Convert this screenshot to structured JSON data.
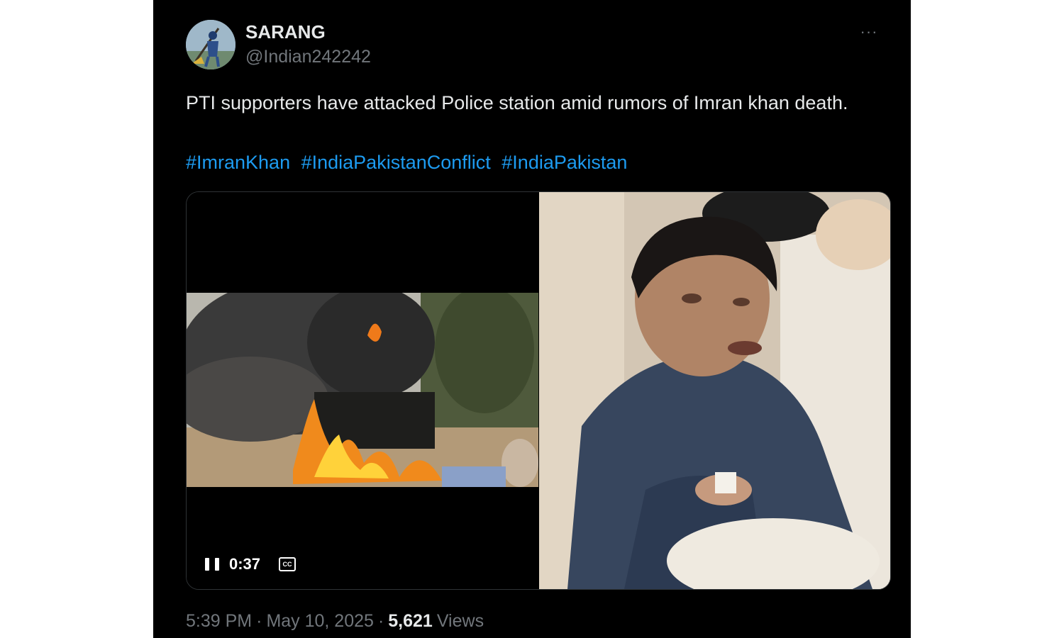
{
  "user": {
    "display_name": "SARANG",
    "handle": "@Indian242242"
  },
  "more_label": "···",
  "tweet": {
    "text": "PTI supporters have attacked Police station amid rumors of Imran khan death.",
    "hashtags": [
      "#ImranKhan",
      "#IndiaPakistanConflict",
      "#IndiaPakistan"
    ]
  },
  "video": {
    "time": "0:37",
    "cc_label": "CC"
  },
  "meta": {
    "time": "5:39 PM",
    "separator": "·",
    "date": "May 10, 2025",
    "views_count": "5,621",
    "views_label": "Views"
  },
  "colors": {
    "background": "#000000",
    "text": "#e7e9ea",
    "secondary": "#71767b",
    "link": "#1d9bf0"
  }
}
